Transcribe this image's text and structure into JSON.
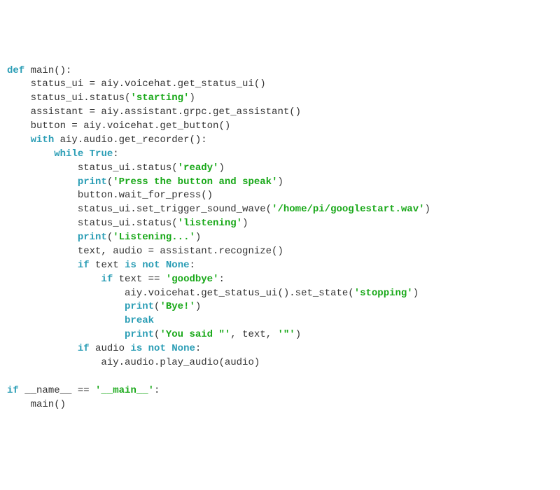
{
  "code": {
    "lines": [
      [
        {
          "t": "kw",
          "v": "def"
        },
        {
          "t": "fn",
          "v": " main():"
        }
      ],
      [
        {
          "t": "fn",
          "v": "    status_ui = aiy.voicehat.get_status_ui()"
        }
      ],
      [
        {
          "t": "fn",
          "v": "    status_ui.status("
        },
        {
          "t": "str",
          "v": "'starting'"
        },
        {
          "t": "fn",
          "v": ")"
        }
      ],
      [
        {
          "t": "fn",
          "v": "    assistant = aiy.assistant.grpc.get_assistant()"
        }
      ],
      [
        {
          "t": "fn",
          "v": "    button = aiy.voicehat.get_button()"
        }
      ],
      [
        {
          "t": "fn",
          "v": "    "
        },
        {
          "t": "kw",
          "v": "with"
        },
        {
          "t": "fn",
          "v": " aiy.audio.get_recorder():"
        }
      ],
      [
        {
          "t": "fn",
          "v": "        "
        },
        {
          "t": "kw",
          "v": "while"
        },
        {
          "t": "fn",
          "v": " "
        },
        {
          "t": "logic",
          "v": "True"
        },
        {
          "t": "fn",
          "v": ":"
        }
      ],
      [
        {
          "t": "fn",
          "v": "            status_ui.status("
        },
        {
          "t": "str",
          "v": "'ready'"
        },
        {
          "t": "fn",
          "v": ")"
        }
      ],
      [
        {
          "t": "fn",
          "v": "            "
        },
        {
          "t": "builtin",
          "v": "print"
        },
        {
          "t": "fn",
          "v": "("
        },
        {
          "t": "str",
          "v": "'Press the button and speak'"
        },
        {
          "t": "fn",
          "v": ")"
        }
      ],
      [
        {
          "t": "fn",
          "v": "            button.wait_for_press()"
        }
      ],
      [
        {
          "t": "fn",
          "v": "            status_ui.set_trigger_sound_wave("
        },
        {
          "t": "str",
          "v": "'/home/pi/googlestart.wav'"
        },
        {
          "t": "fn",
          "v": ")"
        }
      ],
      [
        {
          "t": "fn",
          "v": "            status_ui.status("
        },
        {
          "t": "str",
          "v": "'listening'"
        },
        {
          "t": "fn",
          "v": ")"
        }
      ],
      [
        {
          "t": "fn",
          "v": "            "
        },
        {
          "t": "builtin",
          "v": "print"
        },
        {
          "t": "fn",
          "v": "("
        },
        {
          "t": "str",
          "v": "'Listening...'"
        },
        {
          "t": "fn",
          "v": ")"
        }
      ],
      [
        {
          "t": "fn",
          "v": "            text, audio = assistant.recognize()"
        }
      ],
      [
        {
          "t": "fn",
          "v": "            "
        },
        {
          "t": "kw",
          "v": "if"
        },
        {
          "t": "fn",
          "v": " text "
        },
        {
          "t": "kw",
          "v": "is not"
        },
        {
          "t": "fn",
          "v": " "
        },
        {
          "t": "logic",
          "v": "None"
        },
        {
          "t": "fn",
          "v": ":"
        }
      ],
      [
        {
          "t": "fn",
          "v": "                "
        },
        {
          "t": "kw",
          "v": "if"
        },
        {
          "t": "fn",
          "v": " text == "
        },
        {
          "t": "str",
          "v": "'goodbye'"
        },
        {
          "t": "fn",
          "v": ":"
        }
      ],
      [
        {
          "t": "fn",
          "v": "                    aiy.voicehat.get_status_ui().set_state("
        },
        {
          "t": "str",
          "v": "'stopping'"
        },
        {
          "t": "fn",
          "v": ")"
        }
      ],
      [
        {
          "t": "fn",
          "v": "                    "
        },
        {
          "t": "builtin",
          "v": "print"
        },
        {
          "t": "fn",
          "v": "("
        },
        {
          "t": "str",
          "v": "'Bye!'"
        },
        {
          "t": "fn",
          "v": ")"
        }
      ],
      [
        {
          "t": "fn",
          "v": "                    "
        },
        {
          "t": "kw",
          "v": "break"
        }
      ],
      [
        {
          "t": "fn",
          "v": "                    "
        },
        {
          "t": "builtin",
          "v": "print"
        },
        {
          "t": "fn",
          "v": "("
        },
        {
          "t": "str",
          "v": "'You said \"'"
        },
        {
          "t": "fn",
          "v": ", text, "
        },
        {
          "t": "str",
          "v": "'\"'"
        },
        {
          "t": "fn",
          "v": ")"
        }
      ],
      [
        {
          "t": "fn",
          "v": "            "
        },
        {
          "t": "kw",
          "v": "if"
        },
        {
          "t": "fn",
          "v": " audio "
        },
        {
          "t": "kw",
          "v": "is not"
        },
        {
          "t": "fn",
          "v": " "
        },
        {
          "t": "logic",
          "v": "None"
        },
        {
          "t": "fn",
          "v": ":"
        }
      ],
      [
        {
          "t": "fn",
          "v": "                aiy.audio.play_audio(audio)"
        }
      ],
      [
        {
          "t": "fn",
          "v": ""
        }
      ],
      [
        {
          "t": "kw",
          "v": "if"
        },
        {
          "t": "fn",
          "v": " __name__ == "
        },
        {
          "t": "str",
          "v": "'__main__'"
        },
        {
          "t": "fn",
          "v": ":"
        }
      ],
      [
        {
          "t": "fn",
          "v": "    main()"
        }
      ]
    ]
  }
}
